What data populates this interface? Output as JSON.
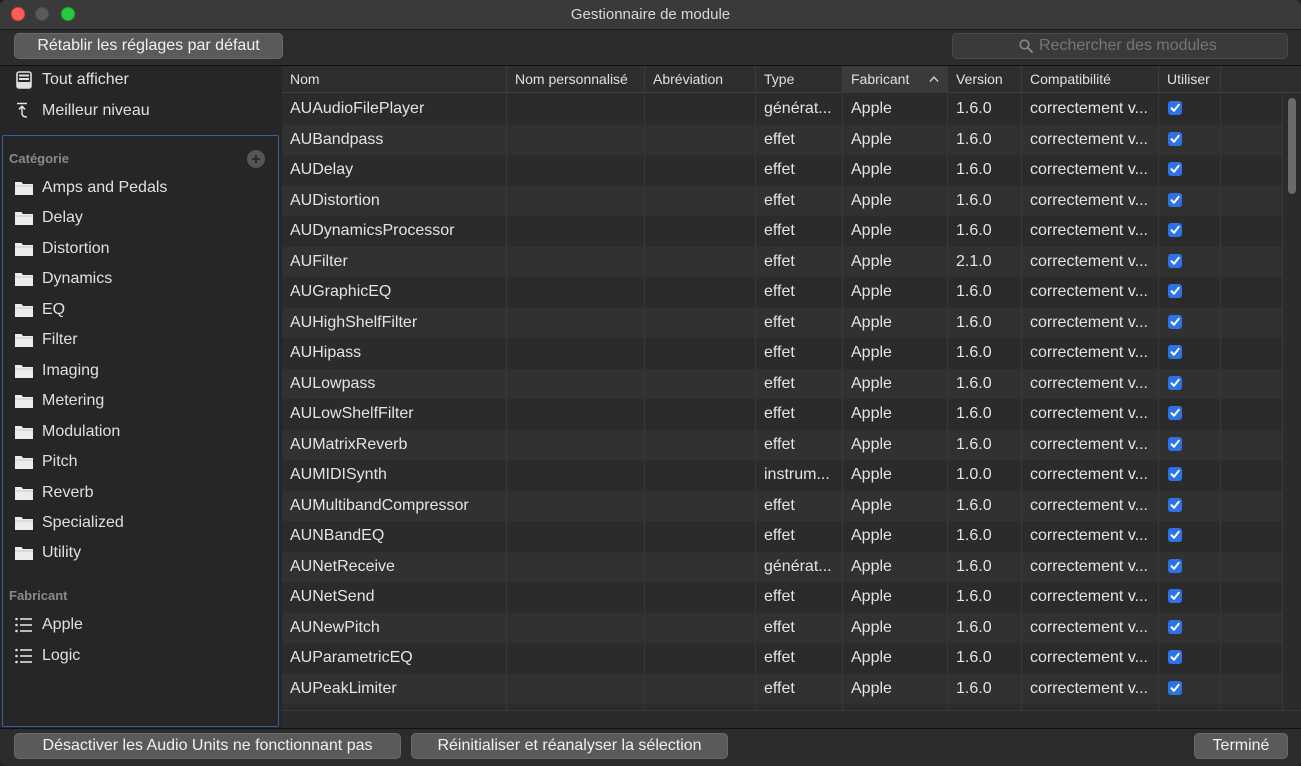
{
  "window": {
    "title": "Gestionnaire de module"
  },
  "toolbar": {
    "reset_label": "Rétablir les réglages par défaut",
    "search_placeholder": "Rechercher des modules"
  },
  "sidebar": {
    "top_items": [
      {
        "label": "Tout afficher",
        "icon": "tray-icon"
      },
      {
        "label": "Meilleur niveau",
        "icon": "arrow-up-icon"
      }
    ],
    "category_heading": "Catégorie",
    "categories": [
      "Amps and Pedals",
      "Delay",
      "Distortion",
      "Dynamics",
      "EQ",
      "Filter",
      "Imaging",
      "Metering",
      "Modulation",
      "Pitch",
      "Reverb",
      "Specialized",
      "Utility"
    ],
    "manufacturer_heading": "Fabricant",
    "manufacturers": [
      "Apple",
      "Logic"
    ]
  },
  "table": {
    "columns": [
      "Nom",
      "Nom personnalisé",
      "Abréviation",
      "Type",
      "Fabricant",
      "Version",
      "Compatibilité",
      "Utiliser"
    ],
    "sorted_column": "Fabricant",
    "rows": [
      {
        "name": "AUAudioFilePlayer",
        "type": "générat...",
        "maker": "Apple",
        "version": "1.6.0",
        "compat": "correctement v...",
        "use": true
      },
      {
        "name": "AUBandpass",
        "type": "effet",
        "maker": "Apple",
        "version": "1.6.0",
        "compat": "correctement v...",
        "use": true
      },
      {
        "name": "AUDelay",
        "type": "effet",
        "maker": "Apple",
        "version": "1.6.0",
        "compat": "correctement v...",
        "use": true
      },
      {
        "name": "AUDistortion",
        "type": "effet",
        "maker": "Apple",
        "version": "1.6.0",
        "compat": "correctement v...",
        "use": true
      },
      {
        "name": "AUDynamicsProcessor",
        "type": "effet",
        "maker": "Apple",
        "version": "1.6.0",
        "compat": "correctement v...",
        "use": true
      },
      {
        "name": "AUFilter",
        "type": "effet",
        "maker": "Apple",
        "version": "2.1.0",
        "compat": "correctement v...",
        "use": true
      },
      {
        "name": "AUGraphicEQ",
        "type": "effet",
        "maker": "Apple",
        "version": "1.6.0",
        "compat": "correctement v...",
        "use": true
      },
      {
        "name": "AUHighShelfFilter",
        "type": "effet",
        "maker": "Apple",
        "version": "1.6.0",
        "compat": "correctement v...",
        "use": true
      },
      {
        "name": "AUHipass",
        "type": "effet",
        "maker": "Apple",
        "version": "1.6.0",
        "compat": "correctement v...",
        "use": true
      },
      {
        "name": "AULowpass",
        "type": "effet",
        "maker": "Apple",
        "version": "1.6.0",
        "compat": "correctement v...",
        "use": true
      },
      {
        "name": "AULowShelfFilter",
        "type": "effet",
        "maker": "Apple",
        "version": "1.6.0",
        "compat": "correctement v...",
        "use": true
      },
      {
        "name": "AUMatrixReverb",
        "type": "effet",
        "maker": "Apple",
        "version": "1.6.0",
        "compat": "correctement v...",
        "use": true
      },
      {
        "name": "AUMIDISynth",
        "type": "instrum...",
        "maker": "Apple",
        "version": "1.0.0",
        "compat": "correctement v...",
        "use": true
      },
      {
        "name": "AUMultibandCompressor",
        "type": "effet",
        "maker": "Apple",
        "version": "1.6.0",
        "compat": "correctement v...",
        "use": true
      },
      {
        "name": "AUNBandEQ",
        "type": "effet",
        "maker": "Apple",
        "version": "1.6.0",
        "compat": "correctement v...",
        "use": true
      },
      {
        "name": "AUNetReceive",
        "type": "générat...",
        "maker": "Apple",
        "version": "1.6.0",
        "compat": "correctement v...",
        "use": true
      },
      {
        "name": "AUNetSend",
        "type": "effet",
        "maker": "Apple",
        "version": "1.6.0",
        "compat": "correctement v...",
        "use": true
      },
      {
        "name": "AUNewPitch",
        "type": "effet",
        "maker": "Apple",
        "version": "1.6.0",
        "compat": "correctement v...",
        "use": true
      },
      {
        "name": "AUParametricEQ",
        "type": "effet",
        "maker": "Apple",
        "version": "1.6.0",
        "compat": "correctement v...",
        "use": true
      },
      {
        "name": "AUPeakLimiter",
        "type": "effet",
        "maker": "Apple",
        "version": "1.6.0",
        "compat": "correctement v...",
        "use": true
      }
    ]
  },
  "footer": {
    "disable_label": "Désactiver les Audio Units ne fonctionnant pas",
    "rescan_label": "Réinitialiser et réanalyser la sélection",
    "done_label": "Terminé"
  },
  "colors": {
    "accent": "#2d73e8",
    "selection_border": "#3b5ea8",
    "close": "#fe5f57",
    "maximize": "#28c840"
  }
}
